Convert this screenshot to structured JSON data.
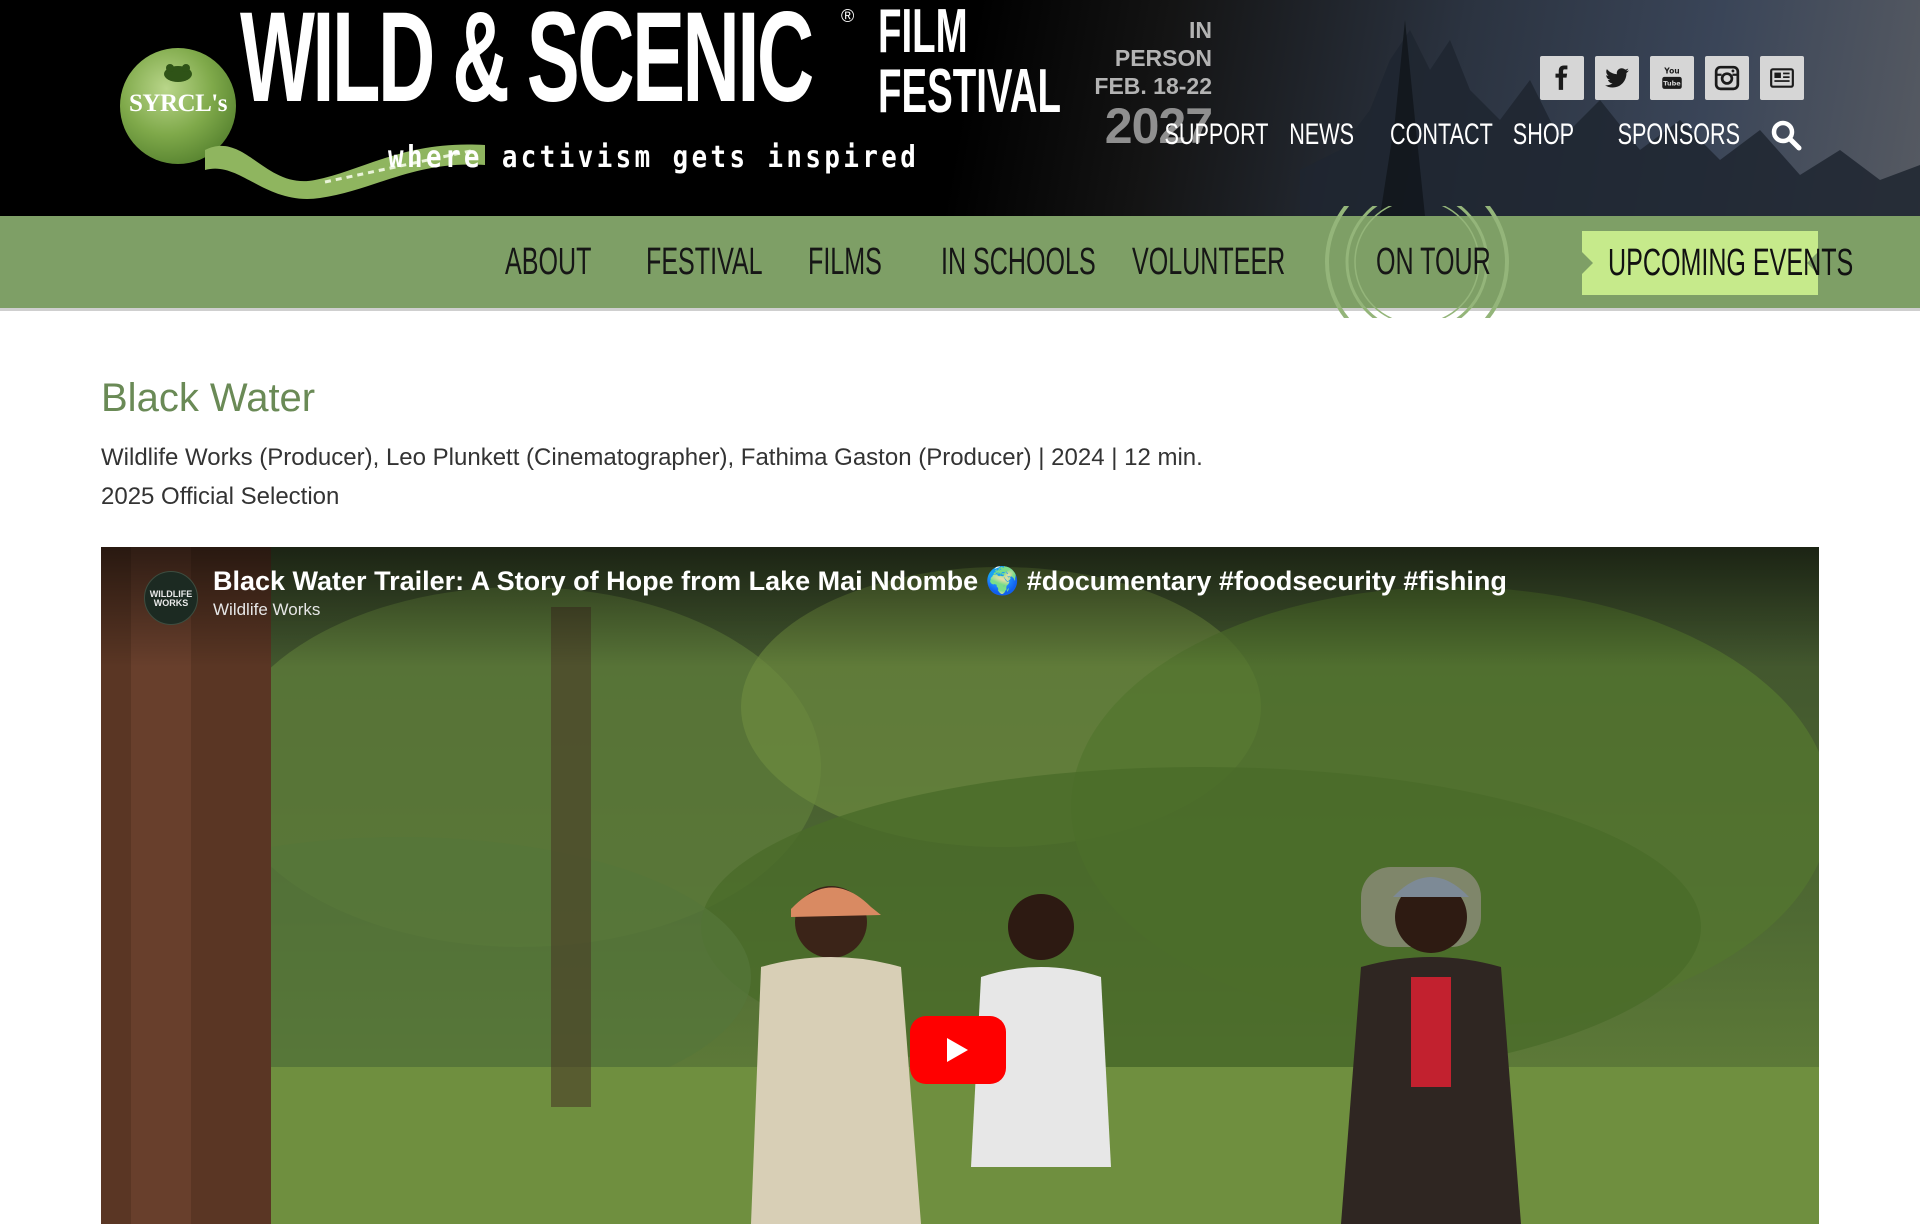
{
  "header": {
    "logo": {
      "badge_text": "SYRCL's",
      "title": "WILD & SCENIC",
      "registered": "®",
      "film_line1": "FILM",
      "film_line2": "FESTIVAL",
      "tagline": "where activism gets inspired"
    },
    "event": {
      "line1": "IN PERSON",
      "line2": "FEB. 18-22",
      "year": "2027"
    },
    "social": [
      {
        "icon": "facebook-icon"
      },
      {
        "icon": "twitter-icon"
      },
      {
        "icon": "youtube-icon"
      },
      {
        "icon": "instagram-icon"
      },
      {
        "icon": "newsletter-icon"
      }
    ],
    "utility_nav": [
      "SUPPORT",
      "NEWS",
      "CONTACT",
      "SHOP",
      "SPONSORS"
    ],
    "search_icon": "search-icon"
  },
  "main_nav": {
    "items": [
      "ABOUT",
      "FESTIVAL",
      "FILMS",
      "IN SCHOOLS",
      "VOLUNTEER",
      "ON TOUR"
    ],
    "cta": "UPCOMING EVENTS"
  },
  "film": {
    "title": "Black Water",
    "credits": "Wildlife Works (Producer), Leo Plunkett (Cinematographer), Fathima Gaston (Producer) | 2024 | 12 min.",
    "selection": "2025 Official Selection"
  },
  "video": {
    "title": "Black Water Trailer: A Story of Hope from Lake Mai Ndombe 🌍 #documentary #foodsecurity #fishing",
    "channel": "Wildlife Works",
    "avatar_text": "WILDLIFE WORKS"
  },
  "colors": {
    "nav_green": "#7e9f66",
    "cta_green": "#c6ea8b",
    "title_green": "#6a8a56",
    "play_red": "#ff0000"
  }
}
